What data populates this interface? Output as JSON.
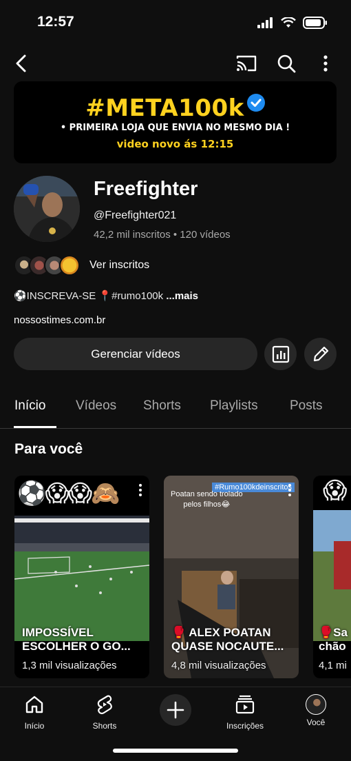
{
  "status": {
    "time": "12:57"
  },
  "banner": {
    "title": "#META100k",
    "line2": "PRIMEIRA LOJA QUE ENVIA NO MESMO DIA !",
    "line3": "video novo ás 12:15"
  },
  "channel": {
    "name": "Freefighter",
    "handle": "@Freefighter021",
    "subscribers": "42,2 mil inscritos",
    "videos": "120 vídeos",
    "see_subscribers": "Ver inscritos",
    "description": "⚽INSCREVA-SE 📍#rumo100k",
    "more": "...mais",
    "link": "nossostimes.com.br"
  },
  "actions": {
    "manage": "Gerenciar vídeos"
  },
  "tabs": [
    {
      "label": "Início"
    },
    {
      "label": "Vídeos"
    },
    {
      "label": "Shorts"
    },
    {
      "label": "Playlists"
    },
    {
      "label": "Posts"
    }
  ],
  "section": {
    "title": "Para você"
  },
  "cards": [
    {
      "emojis": "⚽😱😱🙈",
      "title": "IMPOSSÍVEL\nESCOLHER O GO...",
      "views": "1,3 mil visualizações"
    },
    {
      "overlay_tag": "#Rumo100kdeinscritos",
      "overlay_text": "Poatan sendo trolado\npelos filhos😂",
      "title": "🥊 ALEX POATAN\nQUASE NOCAUTE...",
      "views": "4,8 mil visualizações"
    },
    {
      "title": "🥊Sa\nchão",
      "views": "4,1 mi"
    }
  ],
  "nav": [
    {
      "label": "Início",
      "icon": "home-icon"
    },
    {
      "label": "Shorts",
      "icon": "shorts-icon"
    },
    {
      "label": "",
      "icon": "create-icon"
    },
    {
      "label": "Inscrições",
      "icon": "subscriptions-icon"
    },
    {
      "label": "Você",
      "icon": "avatar-icon"
    }
  ],
  "colors": {
    "background": "#0f0f0f",
    "button": "#272727",
    "accent_yellow": "#ffd21f",
    "verified_blue": "#1e8bf0"
  }
}
